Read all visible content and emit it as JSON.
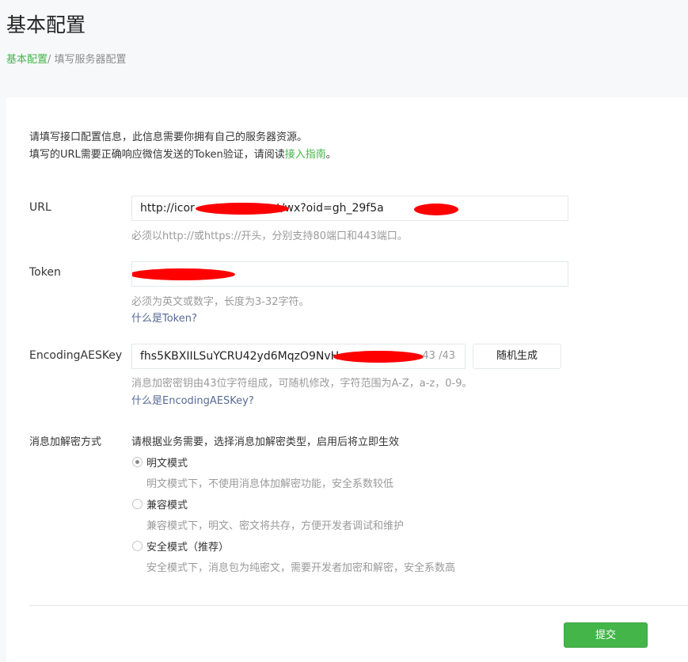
{
  "header": {
    "title": "基本配置",
    "breadcrumb": {
      "root": "基本配置",
      "separator": "/",
      "current": " 填写服务器配置"
    }
  },
  "intro": {
    "line1": "请填写接口配置信息，此信息需要你拥有自己的服务器资源。",
    "line2_prefix": "填写的URL需要正确响应微信发送的Token验证，请阅读",
    "line2_link": "接入指南",
    "line2_suffix": "。"
  },
  "url": {
    "label": "URL",
    "value_start": "http://icor",
    "value_mid": "net/wx?oid=gh_29f5a",
    "tip": "必须以http://或https://开头，分别支持80端口和443端口。"
  },
  "token": {
    "label": "Token",
    "tip": "必须为英文或数字，长度为3-32字符。",
    "help": "什么是Token?"
  },
  "aes": {
    "label": "EncodingAESKey",
    "value_start": "fhs5KBXIILSuYCRU42yd6MqzO9NvH",
    "counter": "43 /43",
    "random_button": "随机生成",
    "tip": "消息加密密钥由43位字符组成，可随机修改，字符范围为A-Z，a-z，0-9。",
    "help": "什么是EncodingAESKey?"
  },
  "encryption": {
    "label": "消息加解密方式",
    "intro": "请根据业务需要，选择消息加解密类型，启用后将立即生效",
    "options": [
      {
        "label": "明文模式",
        "desc": "明文模式下，不使用消息体加解密功能，安全系数较低",
        "checked": true
      },
      {
        "label": "兼容模式",
        "desc": "兼容模式下，明文、密文将共存，方便开发者调试和维护",
        "checked": false
      },
      {
        "label": "安全模式（推荐）",
        "desc": "安全模式下，消息包为纯密文，需要开发者加密和解密，安全系数高",
        "checked": false
      }
    ]
  },
  "footer": {
    "submit": "提交"
  },
  "colors": {
    "accent": "#44b549",
    "link": "#576b95",
    "redaction": "#ff0000"
  }
}
